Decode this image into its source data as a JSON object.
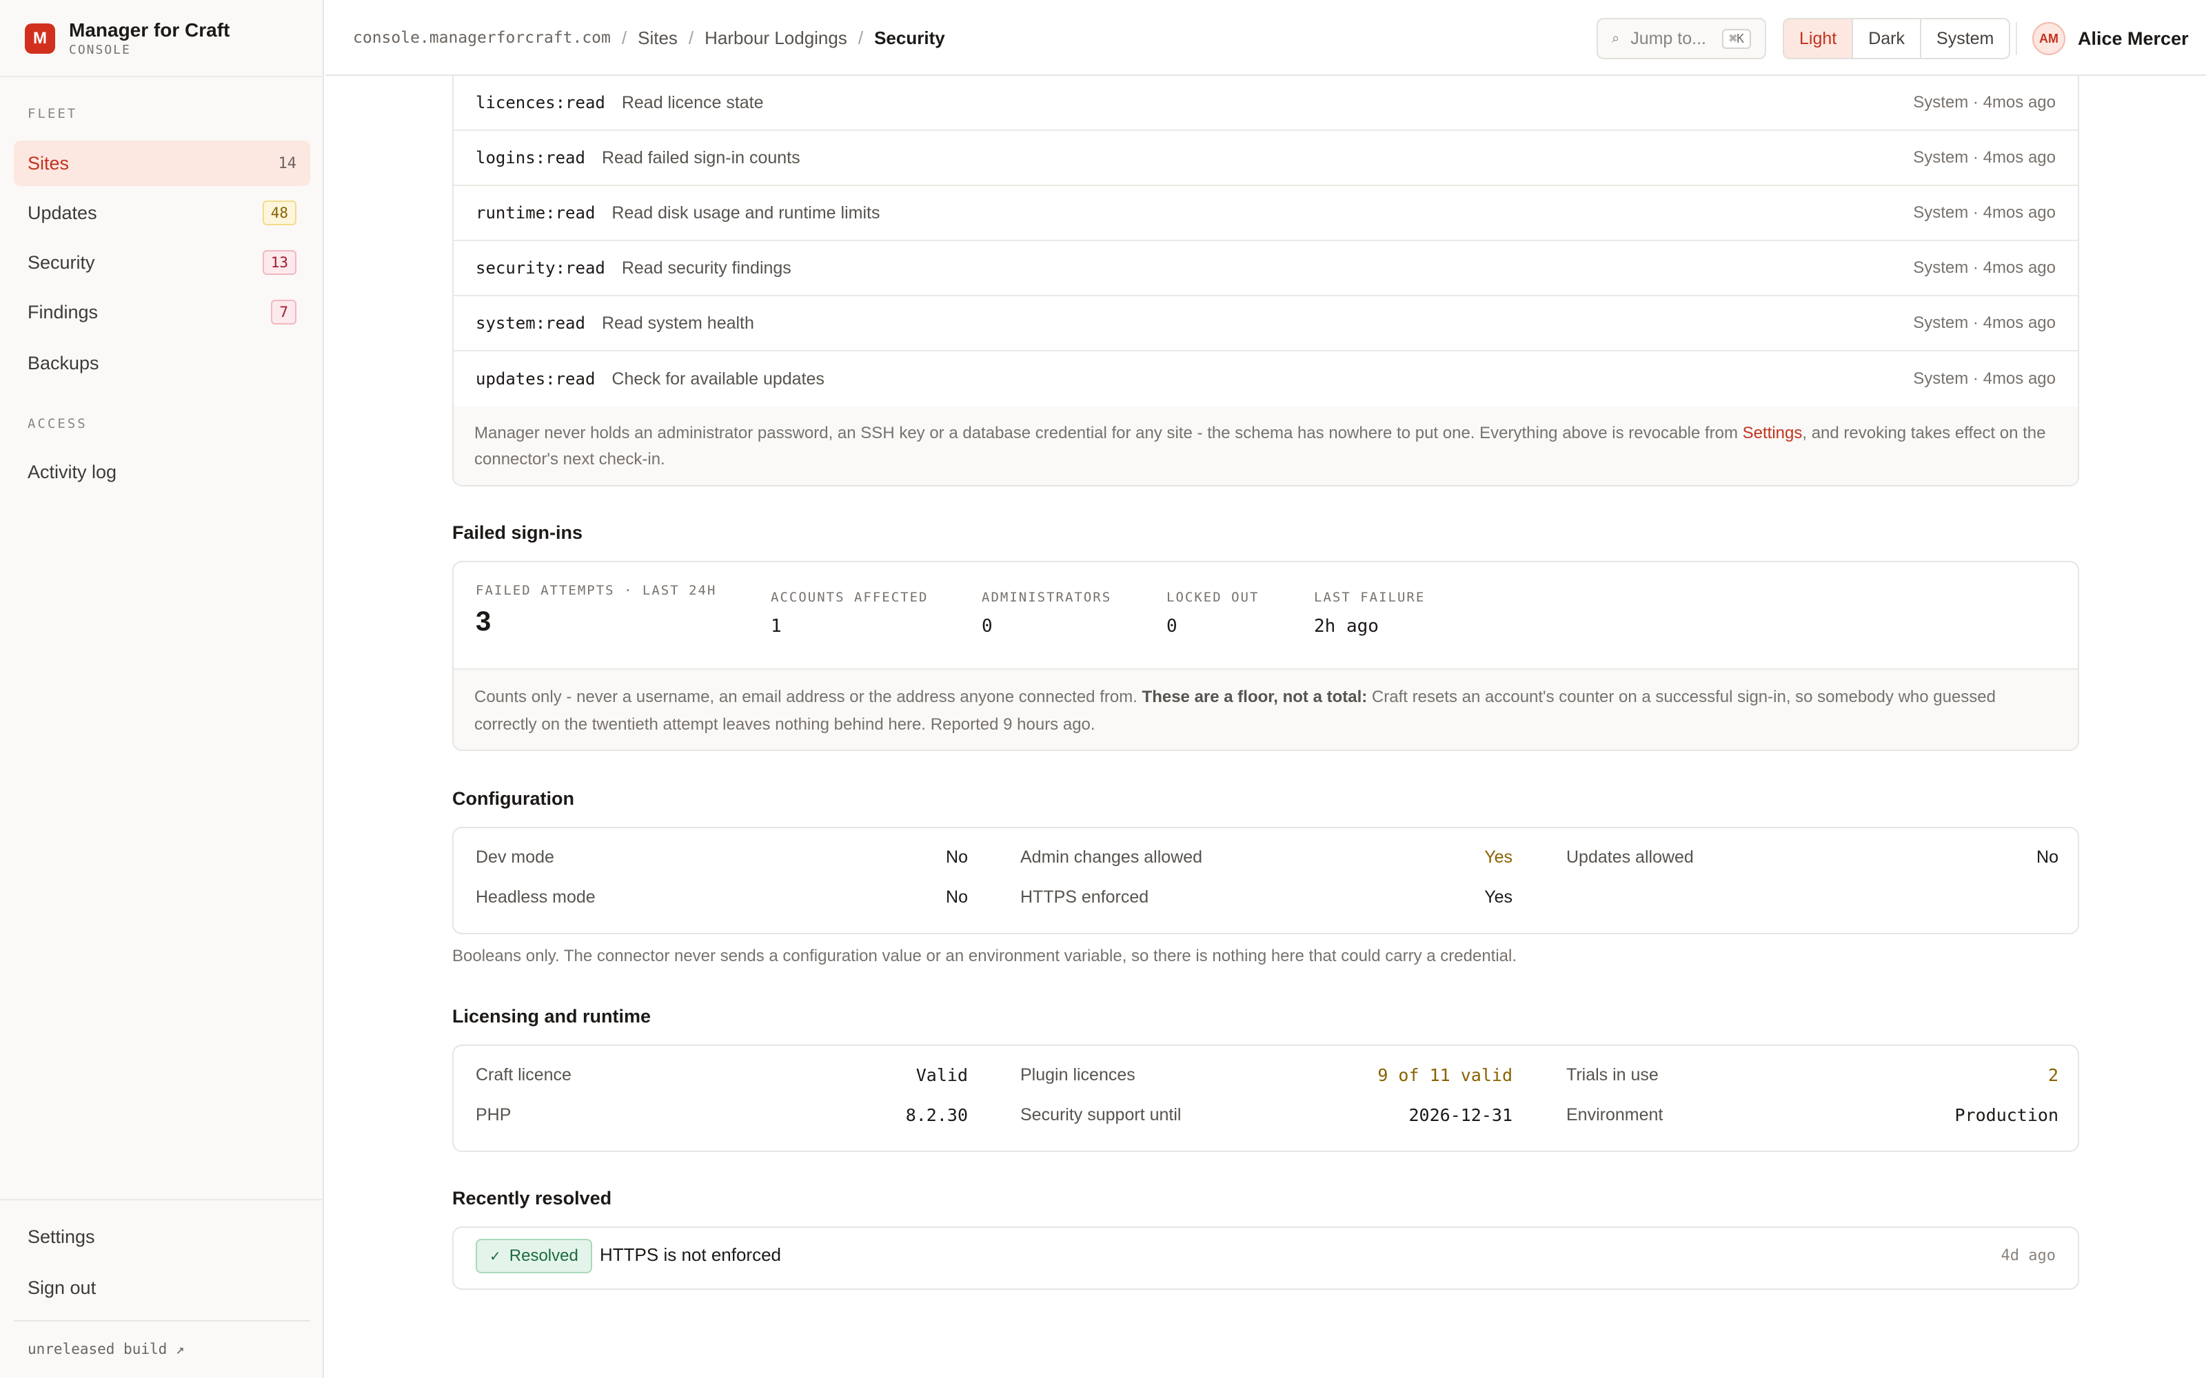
{
  "brand": {
    "logo_letter": "M",
    "name": "Manager for Craft",
    "subtitle": "CONSOLE"
  },
  "sidebar": {
    "fleet_label": "FLEET",
    "items": [
      {
        "label": "Sites",
        "count": "14",
        "active": true
      },
      {
        "label": "Updates",
        "count": "48",
        "badge": "amber"
      },
      {
        "label": "Security",
        "count": "13",
        "badge": "red"
      },
      {
        "label": "Findings",
        "count": "7",
        "badge": "red"
      },
      {
        "label": "Backups"
      }
    ],
    "access_label": "ACCESS",
    "access_items": [
      {
        "label": "Activity log"
      }
    ],
    "bottom_items": [
      {
        "label": "Settings"
      },
      {
        "label": "Sign out"
      }
    ],
    "build_label": "unreleased build ↗"
  },
  "topbar": {
    "breadcrumb": [
      {
        "label": "console.managerforcraft.com"
      },
      {
        "label": "Sites"
      },
      {
        "label": "Harbour Lodgings"
      },
      {
        "label": "Security"
      }
    ],
    "separator": "/",
    "jump_placeholder": "Jump to...",
    "jump_shortcut": "⌘K",
    "theme_options": [
      "Light",
      "Dark",
      "System"
    ],
    "theme_selected": "Light",
    "user": {
      "initials": "AM",
      "name": "Alice Mercer"
    }
  },
  "scopes": {
    "rows": [
      {
        "code": "licences:read",
        "desc": "Read licence state",
        "meta": "System · 4mos ago"
      },
      {
        "code": "logins:read",
        "desc": "Read failed sign-in counts",
        "meta": "System · 4mos ago"
      },
      {
        "code": "runtime:read",
        "desc": "Read disk usage and runtime limits",
        "meta": "System · 4mos ago"
      },
      {
        "code": "security:read",
        "desc": "Read security findings",
        "meta": "System · 4mos ago"
      },
      {
        "code": "system:read",
        "desc": "Read system health",
        "meta": "System · 4mos ago"
      },
      {
        "code": "updates:read",
        "desc": "Check for available updates",
        "meta": "System · 4mos ago"
      }
    ],
    "note_before_link": "Manager never holds an administrator password, an SSH key or a database credential for any site - the schema has nowhere to put one. Everything above is revocable from ",
    "note_link": "Settings",
    "note_after_link": ", and revoking takes effect on the connector's next check-in."
  },
  "failed_signins": {
    "title": "Failed sign-ins",
    "stats": [
      {
        "label": "FAILED ATTEMPTS · LAST 24H",
        "value": "3"
      },
      {
        "label": "ACCOUNTS AFFECTED",
        "value": "1"
      },
      {
        "label": "ADMINISTRATORS",
        "value": "0"
      },
      {
        "label": "LOCKED OUT",
        "value": "0"
      },
      {
        "label": "LAST FAILURE",
        "value": "2h ago"
      }
    ],
    "note_intro": "Counts only - never a username, an email address or the address anyone connected from. ",
    "note_bold": "These are a floor, not a total:",
    "note_rest": " Craft resets an account's counter on a successful sign-in, so somebody who guessed correctly on the twentieth attempt leaves nothing behind here. Reported 9 hours ago."
  },
  "configuration": {
    "title": "Configuration",
    "items": [
      {
        "key": "Dev mode",
        "value": "No"
      },
      {
        "key": "Admin changes allowed",
        "value": "Yes",
        "warn": true
      },
      {
        "key": "Updates allowed",
        "value": "No"
      },
      {
        "key": "Headless mode",
        "value": "No"
      },
      {
        "key": "HTTPS enforced",
        "value": "Yes"
      }
    ],
    "note": "Booleans only. The connector never sends a configuration value or an environment variable, so there is nothing here that could carry a credential."
  },
  "licensing": {
    "title": "Licensing and runtime",
    "items": [
      {
        "key": "Craft licence",
        "value": "Valid"
      },
      {
        "key": "Plugin licences",
        "value": "9 of 11 valid",
        "warn": true
      },
      {
        "key": "Trials in use",
        "value": "2",
        "warn": true
      },
      {
        "key": "PHP",
        "value": "8.2.30"
      },
      {
        "key": "Security support until",
        "value": "2026-12-31"
      },
      {
        "key": "Environment",
        "value": "Production"
      }
    ]
  },
  "recently_resolved": {
    "title": "Recently resolved",
    "items": [
      {
        "badge": "Resolved",
        "check": "✓",
        "title": "HTTPS is not enforced",
        "time": "4d ago"
      }
    ]
  },
  "colors": {
    "accent": "#c2331e",
    "warn": "#8a6200",
    "success": "#1d6b3e"
  }
}
